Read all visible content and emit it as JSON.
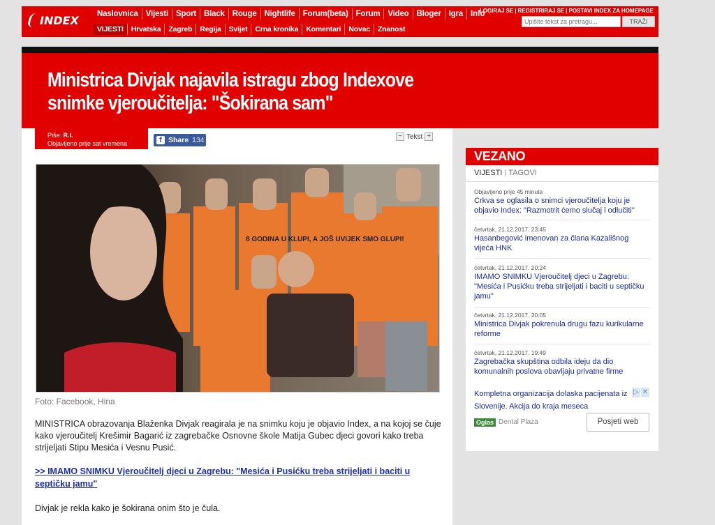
{
  "header": {
    "logo_text": "INDEX",
    "nav_primary": [
      "Naslovnica",
      "Vijesti",
      "Sport",
      "Black",
      "Rouge",
      "Nightlife",
      "Forum(beta)",
      "Forum",
      "Video",
      "Bloger",
      "Igra",
      "Info"
    ],
    "nav_secondary": [
      "VIJESTI",
      "Hrvatska",
      "Zagreb",
      "Regija",
      "Svijet",
      "Crna kronika",
      "Komentari",
      "Novac",
      "Znanost"
    ],
    "user_links": [
      "LOGIRAJ SE",
      "REGISTRIRAJ SE",
      "POSTAVI INDEX ZA HOMEPAGE"
    ],
    "search_placeholder": "Upišite tekst za pretragu...",
    "search_button": "TRAŽI"
  },
  "article": {
    "headline": "Ministrica Divjak najavila istragu zbog Indexove snimke vjeroučitelja: \"Šokirana sam\"",
    "author_label": "Piše:",
    "author": "R.I.",
    "published": "Objavljeno prije sat vremena",
    "share_label": "Share",
    "share_count": "134",
    "text_size_label": "Tekst",
    "text_minus": "−",
    "text_plus": "+",
    "photo_shirt_text": "8 GODINA U KLUPI, A JOŠ UVIJEK SMO GLUPI!",
    "photo_caption": "Foto: Facebook, Hina",
    "paragraph1": "MINISTRICA obrazovanja Blaženka Divjak reagirala je na snimku koju je objavio Index, a na kojoj se čuje kako vjeroučitelj Krešimir Bagarić iz zagrebačke Osnovne škole Matija Gubec djeci govori kako treba strijeljati Stipu Mesića i Vesnu Pusić.",
    "link1": ">> IMAMO SNIMKU Vjeroučitelj djeci u Zagrebu: \"Mesića i Pusićku treba strijeljati i baciti u septičku jamu\"",
    "paragraph2": "Divjak je rekla kako je šokirana onim što je čula."
  },
  "sidebar": {
    "title": "VEZANO",
    "tab1": "VIJESTI",
    "tab2": "TAGOVI",
    "items": [
      {
        "date": "Objavljeno prije 45 minuta",
        "title": "Crkva se oglasila o snimci vjeroučitelja koju je objavio Index: \"Razmotrit ćemo slučaj i odlučiti\""
      },
      {
        "date": "četvrtak, 21.12.2017. 23:45",
        "title": "Hasanbegović imenovan za člana Kazališnog vijeća HNK"
      },
      {
        "date": "četvrtak, 21.12.2017. 20:24",
        "title": "IMAMO SNIMKU Vjeroučitelj djeci u Zagrebu: \"Mesića i Pusićku treba strijeljati i baciti u septičku jamu\""
      },
      {
        "date": "četvrtak, 21.12.2017. 20:05",
        "title": "Ministrica Divjak pokrenula drugu fazu kurikularne reforme"
      },
      {
        "date": "četvrtak, 21.12.2017. 19:49",
        "title": "Zagrebačka skupština odbila ideju da dio komunalnih poslova obavljaju privatne firme"
      }
    ],
    "ad_text": "Kompletna organizacija dolaska pacijenata iz Slovenije. Akcija do kraja meseca",
    "ad_label": "Oglas",
    "ad_brand": "Dental Plaza",
    "ad_button": "Posjeti web"
  },
  "colors": {
    "brand_red": "#e10000",
    "facebook": "#3b5a9a",
    "link": "#1e2fa8"
  }
}
